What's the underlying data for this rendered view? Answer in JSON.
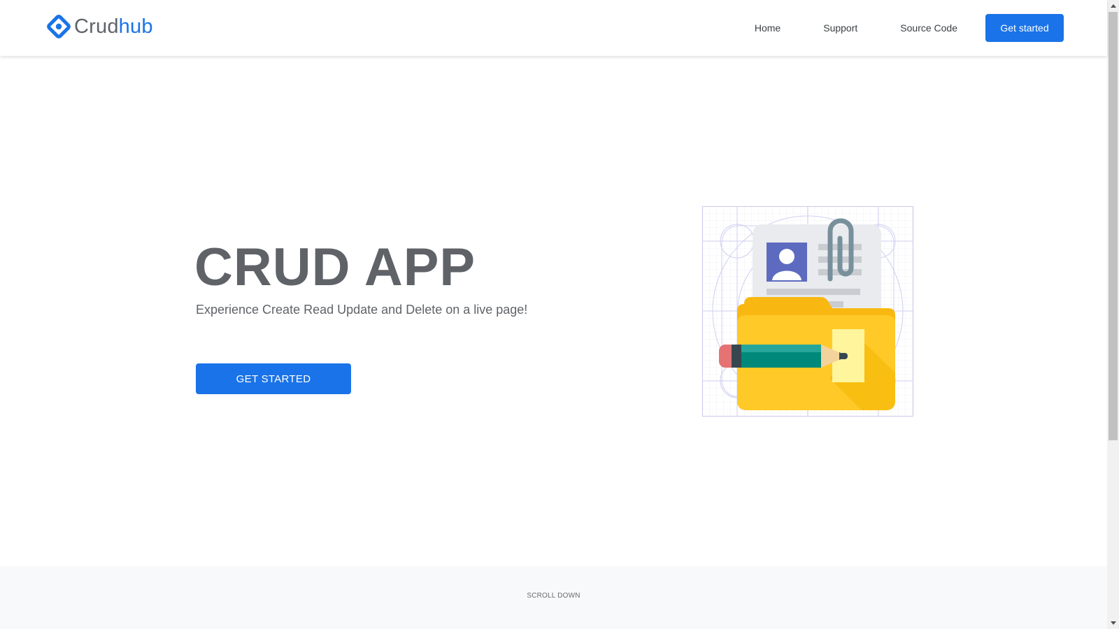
{
  "brand": {
    "name_part1": "Crud",
    "name_part2": "hub",
    "icon": "diamond-logo-icon",
    "color": "#1a73e8"
  },
  "nav": {
    "items": [
      {
        "label": "Home"
      },
      {
        "label": "Support"
      },
      {
        "label": "Source Code"
      }
    ],
    "cta_label": "Get started"
  },
  "hero": {
    "title": "CRUD APP",
    "subtitle": "Experience Create Read Update and Delete on a live page!",
    "button_label": "GET STARTED",
    "illustration_icon": "folder-document-pencil-icon"
  },
  "footer": {
    "scroll_label": "SCROLL DOWN"
  },
  "colors": {
    "accent": "#1a73e8",
    "text": "#5f6368",
    "footer_bg": "#f8f9fa"
  }
}
